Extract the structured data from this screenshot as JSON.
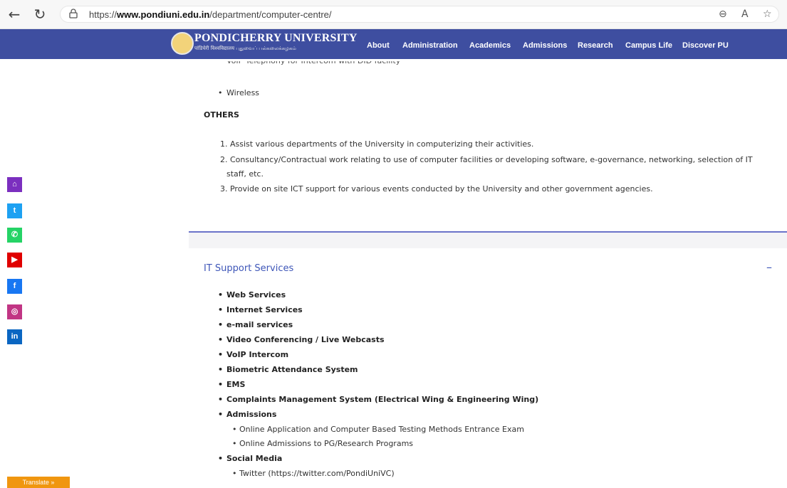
{
  "browser": {
    "url_prefix": "https://",
    "url_domain": "www.pondiuni.edu.in",
    "url_path": "/department/computer-centre/"
  },
  "header": {
    "title": "PONDICHERRY UNIVERSITY",
    "subtitle": "पांडिचेरी विश्वविद्यालय   புதுவைப் பல்கலைக்கழகம்",
    "nav": [
      "About",
      "Administration",
      "Academics",
      "Admissions",
      "Research",
      "Campus Life",
      "Discover PU"
    ]
  },
  "top_section": {
    "partial_bullet": "VoIP Telephony for Intercom with DID facility",
    "bullet_wireless": "Wireless",
    "others_heading": "OTHERS",
    "others": [
      "1. Assist various departments of the University in computerizing their activities.",
      "2. Consultancy/Contractual work relating to use of computer facilities or developing software, e-governance, networking, selection of IT",
      "staff, etc.",
      "3. Provide on site ICT support for various events conducted by the University and other government agencies."
    ]
  },
  "it_support": {
    "title": "IT Support Services",
    "toggle": "–",
    "services": [
      "Web Services",
      "Internet Services",
      "e-mail services",
      "Video Conferencing / Live Webcasts",
      "VoIP Intercom",
      "Biometric Attendance System",
      "EMS",
      "Complaints Management System (Electrical Wing & Engineering Wing)",
      "Admissions"
    ],
    "admissions_sub": [
      "Online Application and Computer Based Testing Methods Entrance Exam",
      "Online Admissions to PG/Research Programs"
    ],
    "social_media": "Social Media",
    "social_sub": [
      "Twitter (https://twitter.com/PondiUniVC)"
    ]
  },
  "social_bar": [
    {
      "icon": "home-icon",
      "color": "#7b2fbf"
    },
    {
      "icon": "twitter-icon",
      "color": "#1da1f2"
    },
    {
      "icon": "whatsapp-icon",
      "color": "#25d366"
    },
    {
      "icon": "youtube-icon",
      "color": "#e00000"
    },
    {
      "icon": "facebook-icon",
      "color": "#1877f2"
    },
    {
      "icon": "instagram-icon",
      "color": "#c13584"
    },
    {
      "icon": "linkedin-icon",
      "color": "#0a66c2"
    }
  ],
  "translate": "Translate »"
}
